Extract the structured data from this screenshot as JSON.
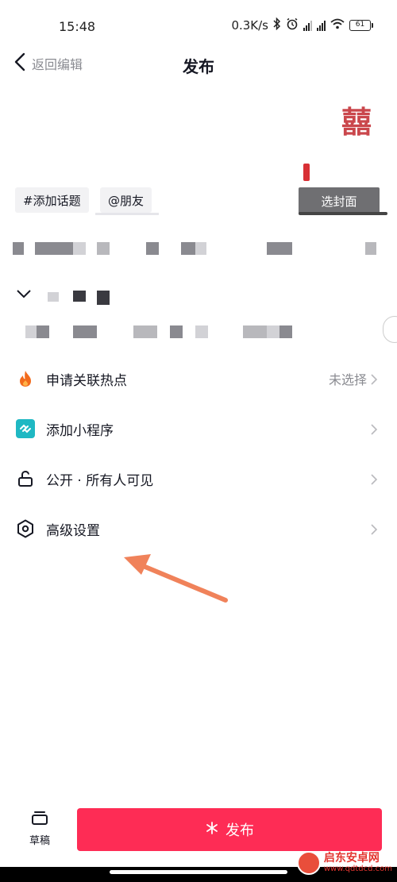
{
  "status_bar": {
    "time": "15:48",
    "net_speed": "0.3K/s",
    "battery": "61"
  },
  "header": {
    "back_label": "返回编辑",
    "title": "发布"
  },
  "caption": {
    "topic_chip": "#添加话题",
    "friend_chip": "@朋友"
  },
  "cover": {
    "button_label": "选封面",
    "art_text": "囍"
  },
  "settings": [
    {
      "id": "hotspot",
      "icon": "flame-icon",
      "label": "申请关联热点",
      "value": "未选择"
    },
    {
      "id": "miniprogram",
      "icon": "mini-program-icon",
      "label": "添加小程序",
      "value": ""
    },
    {
      "id": "visibility",
      "icon": "unlock-icon",
      "label": "公开 · 所有人可见",
      "value": ""
    },
    {
      "id": "advanced",
      "icon": "hexagon-settings-icon",
      "label": "高级设置",
      "value": ""
    }
  ],
  "bottom": {
    "draft_label": "草稿",
    "publish_label": "发布"
  },
  "watermark": {
    "name": "启东安卓网",
    "url": "www.qdtdcd.com"
  },
  "colors": {
    "publish": "#fe2c55",
    "mini_program": "#1fb8c3",
    "flame": "#f26b1d",
    "annotation_arrow": "#f0825a"
  }
}
